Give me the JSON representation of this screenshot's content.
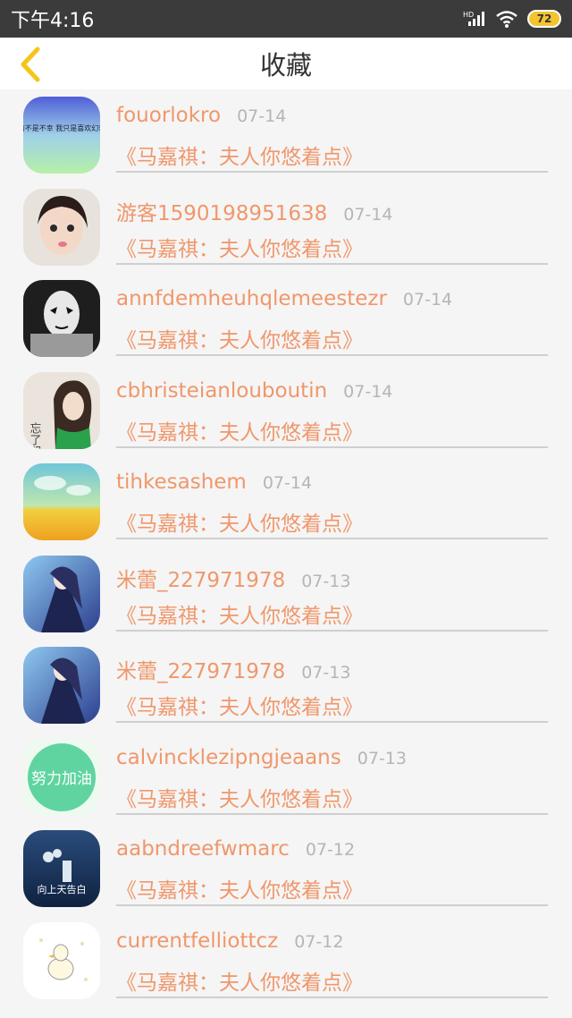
{
  "status_bar": {
    "time": "下午4:16",
    "battery": "72",
    "icons": [
      "hd-signal-icon",
      "wifi-icon",
      "battery-icon"
    ]
  },
  "nav": {
    "title": "收藏",
    "back_icon": "chevron-left-icon"
  },
  "colors": {
    "accent": "#f0976b",
    "back_arrow": "#f5c518",
    "date": "#b5b5b5",
    "status_bar": "#3b3b3b"
  },
  "items": [
    {
      "user": "fouorlokro",
      "date": "07-14",
      "book": "《马嘉祺：夫人你悠着点》",
      "avatar_text": "我真的不是不幸 我只是喜欢幻想未来"
    },
    {
      "user": "游客1590198951638",
      "date": "07-14",
      "book": "《马嘉祺：夫人你悠着点》"
    },
    {
      "user": "annfdemheuhqlemeestezr",
      "date": "07-14",
      "book": "《马嘉祺：夫人你悠着点》"
    },
    {
      "user": "cbhristeianlouboutin",
      "date": "07-14",
      "book": "《马嘉祺：夫人你悠着点》",
      "avatar_text": "忘了哭"
    },
    {
      "user": "tihkesashem",
      "date": "07-14",
      "book": "《马嘉祺：夫人你悠着点》"
    },
    {
      "user": "米蕾_227971978",
      "date": "07-13",
      "book": "《马嘉祺：夫人你悠着点》"
    },
    {
      "user": "米蕾_227971978",
      "date": "07-13",
      "book": "《马嘉祺：夫人你悠着点》"
    },
    {
      "user": "calvincklezipngjeaans",
      "date": "07-13",
      "book": "《马嘉祺：夫人你悠着点》",
      "avatar_text": "努力加油"
    },
    {
      "user": "aabndreefwmarc",
      "date": "07-12",
      "book": "《马嘉祺：夫人你悠着点》",
      "avatar_text": "向上天告白"
    },
    {
      "user": "currentfelliottcz",
      "date": "07-12",
      "book": "《马嘉祺：夫人你悠着点》"
    }
  ]
}
